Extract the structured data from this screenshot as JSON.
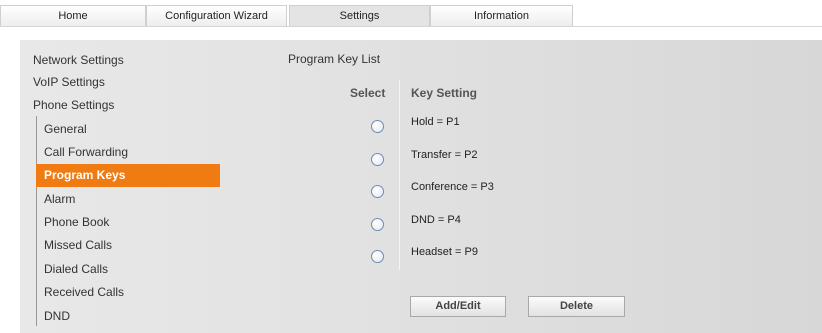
{
  "tabs": [
    {
      "label": "Home"
    },
    {
      "label": "Configuration Wizard"
    },
    {
      "label": "Settings"
    },
    {
      "label": "Information"
    }
  ],
  "active_tab": "Settings",
  "menu": {
    "top": [
      {
        "label": "Network Settings"
      },
      {
        "label": "VoIP Settings"
      },
      {
        "label": "Phone Settings"
      }
    ],
    "sub": [
      {
        "label": "General"
      },
      {
        "label": "Call Forwarding"
      },
      {
        "label": "Program Keys"
      },
      {
        "label": "Alarm"
      },
      {
        "label": "Phone Book"
      },
      {
        "label": "Missed Calls"
      },
      {
        "label": "Dialed Calls"
      },
      {
        "label": "Received Calls"
      },
      {
        "label": "DND"
      }
    ],
    "active_item": "Program Keys"
  },
  "content": {
    "title": "Program Key List",
    "columns": {
      "select": "Select",
      "key_setting": "Key Setting"
    },
    "rows": [
      {
        "key": "Hold = P1",
        "selected": false
      },
      {
        "key": "Transfer = P2",
        "selected": false
      },
      {
        "key": "Conference = P3",
        "selected": false
      },
      {
        "key": "DND = P4",
        "selected": false
      },
      {
        "key": "Headset = P9",
        "selected": false
      }
    ],
    "buttons": {
      "add_edit": "Add/Edit",
      "delete": "Delete"
    }
  },
  "colors": {
    "accent": "#f07b12",
    "panel": "#e3e3e3"
  }
}
